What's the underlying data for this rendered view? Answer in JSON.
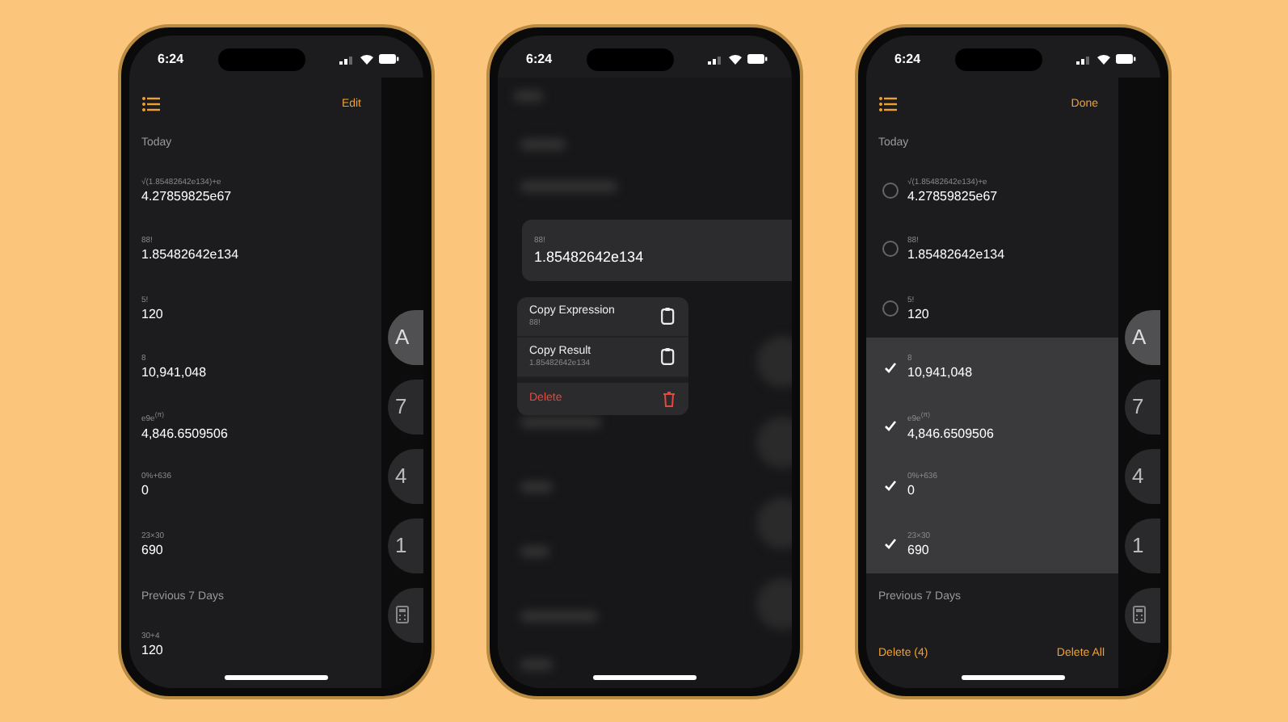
{
  "phones": [
    {
      "kind": "history",
      "status_time": "6:24",
      "nav_action": "Edit",
      "sections": [
        {
          "title": "Today",
          "rows": [
            {
              "expression": "√(1.85482642e134)+e",
              "result": "4.27859825e67"
            },
            {
              "expression": "88!",
              "result": "1.85482642e134"
            },
            {
              "expression": "5!",
              "result": "120"
            },
            {
              "expression": "8",
              "result": "10,941,048"
            },
            {
              "expression": "e9e$^{(π)}$",
              "result": "4,846.6509506"
            },
            {
              "expression": "0%+636",
              "result": "0"
            },
            {
              "expression": "23×30",
              "result": "690"
            }
          ]
        },
        {
          "title": "Previous 7 Days",
          "rows": [
            {
              "expression": "30+4",
              "result": "120"
            }
          ]
        }
      ],
      "keypad": [
        "A",
        "7",
        "4",
        "1"
      ]
    },
    {
      "kind": "menu",
      "status_time": "6:24",
      "card": {
        "expression": "88!",
        "result": "1.85482642e134"
      },
      "menu": [
        {
          "kind": "copy",
          "label": "Copy Expression",
          "detail": "88!"
        },
        {
          "kind": "copy",
          "label": "Copy Result",
          "detail": "1.85482642e134"
        },
        {
          "kind": "delete",
          "label": "Delete"
        }
      ]
    },
    {
      "kind": "edit",
      "status_time": "6:24",
      "nav_action": "Done",
      "sections": [
        {
          "title": "Today",
          "rows": [
            {
              "expression": "√(1.85482642e134)+e",
              "result": "4.27859825e67",
              "selected": false
            },
            {
              "expression": "88!",
              "result": "1.85482642e134",
              "selected": false
            },
            {
              "expression": "5!",
              "result": "120",
              "selected": false
            },
            {
              "expression": "8",
              "result": "10,941,048",
              "selected": true
            },
            {
              "expression": "e9e$^{(π)}$",
              "result": "4,846.6509506",
              "selected": true
            },
            {
              "expression": "0%+636",
              "result": "0",
              "selected": true
            },
            {
              "expression": "23×30",
              "result": "690",
              "selected": true
            }
          ]
        },
        {
          "title": "Previous 7 Days"
        }
      ],
      "footer": {
        "left": "Delete (4)",
        "right": "Delete All"
      },
      "keypad": [
        "A",
        "7",
        "4",
        "1"
      ]
    }
  ]
}
